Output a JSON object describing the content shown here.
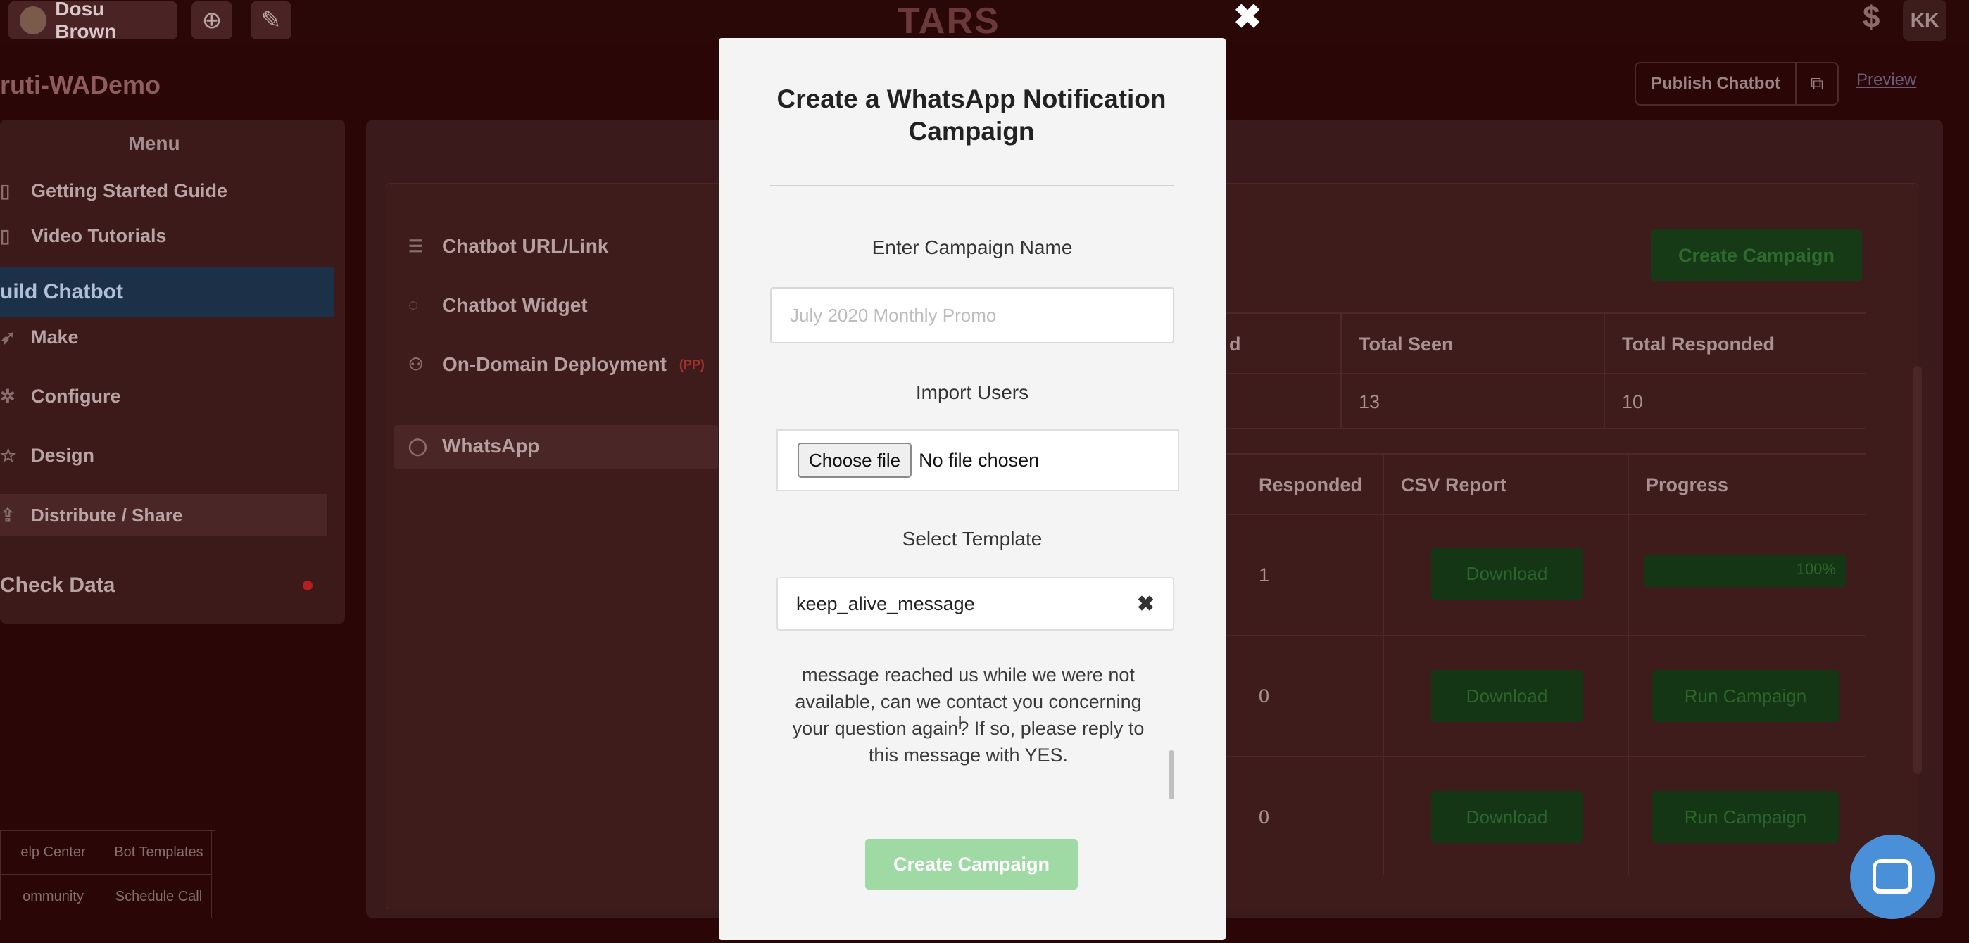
{
  "topbar": {
    "user_name": "Dosu Brown",
    "add_icon": "plus-circle-icon",
    "wand_icon": "magic-wand-icon",
    "brand": "TARS",
    "dollar": "$",
    "user_initials": "KK"
  },
  "header": {
    "bot_title": "ruti-WADemo",
    "publish_label": "Publish Chatbot",
    "preview_label": "Preview"
  },
  "sidebar": {
    "menu_title": "Menu",
    "items": [
      {
        "label": "Getting Started Guide",
        "icon": "doc-icon"
      },
      {
        "label": "Video Tutorials",
        "icon": "video-icon"
      },
      {
        "label": "uild Chatbot"
      },
      {
        "label": "Make",
        "icon": "send-icon"
      },
      {
        "label": "Configure",
        "icon": "gear-icon"
      },
      {
        "label": "Design",
        "icon": "star-icon"
      },
      {
        "label": "Distribute / Share",
        "icon": "share-icon"
      },
      {
        "label": "Check Data"
      }
    ],
    "footer": [
      "elp Center",
      "Bot Templates",
      "ommunity",
      "Schedule Call"
    ]
  },
  "subnav": {
    "items": [
      {
        "label": "Chatbot URL/Link"
      },
      {
        "label": "Chatbot Widget"
      },
      {
        "label": "On-Domain Deployment",
        "badge": "(PP)"
      },
      {
        "label": "WhatsApp"
      }
    ]
  },
  "campaigns": {
    "create_button": "Create Campaign",
    "summary_headers": [
      "d",
      "Total Seen",
      "Total Responded"
    ],
    "summary_values": [
      "13",
      "10"
    ],
    "table_headers": [
      "Responded",
      "CSV Report",
      "Progress"
    ],
    "rows": [
      {
        "responded": "1",
        "csv": "Download",
        "progress_label": "100%",
        "progress_value": 1.0
      },
      {
        "responded": "0",
        "csv": "Download",
        "action": "Run Campaign"
      },
      {
        "responded": "0",
        "csv": "Download",
        "action": "Run Campaign"
      }
    ]
  },
  "modal": {
    "close": "✖",
    "title": "Create a WhatsApp Notification Campaign",
    "name_label": "Enter Campaign Name",
    "name_placeholder": "July 2020 Monthly Promo",
    "import_label": "Import Users",
    "choose_file": "Choose file",
    "no_file": "No file chosen",
    "template_label": "Select Template",
    "template_value": "keep_alive_message",
    "template_clear": "✖",
    "template_preview": "please reply to this message with YES.Your message reached us while we were not available, can we contact you concerning your question again? If so, please reply to this message with YES.",
    "submit": "Create Campaign"
  },
  "colors": {
    "overlay_bg": "#2a0606",
    "modal_bg": "#f4f4f5",
    "submit_bg": "#9fd9a4",
    "chat_fab": "#4a90d9"
  }
}
